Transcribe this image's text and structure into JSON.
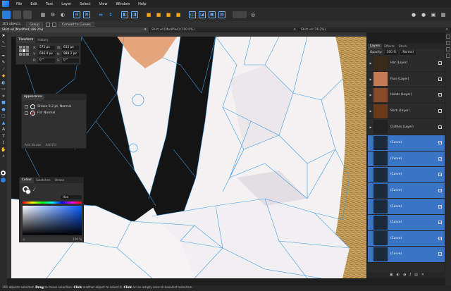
{
  "menu": [
    "File",
    "Edit",
    "Text",
    "Layer",
    "Select",
    "View",
    "Window",
    "Help"
  ],
  "context": {
    "object_count": "101 objects",
    "group_label": "Group",
    "convert_label": "Convert to Curves"
  },
  "doc_tabs": [
    {
      "label": "Shirt.vd [Modified] (86.2%)",
      "active": true
    },
    {
      "label": "Shirt.vd [Modified] (100.0%)",
      "active": false
    },
    {
      "label": "Shirt.vd (36.2%)",
      "active": false
    }
  ],
  "transform": {
    "tabs": [
      "Transform",
      "History"
    ],
    "x": "572 px",
    "w": "615 px",
    "y": "696.4 px",
    "h": "988.2 px",
    "r": "0 °",
    "s": "0 °"
  },
  "appearance": {
    "title": "Appearance",
    "stroke_label": "Stroke 0.2 pt, Normal",
    "fill_label": "Fill: Normal",
    "add_stroke": "Add Stroke",
    "add_fill": "Add Fill"
  },
  "colour": {
    "tabs": [
      "Colour",
      "Swatches",
      "Stroke"
    ],
    "model": "Hue",
    "opacity": "100 %"
  },
  "layers": {
    "tabs": [
      "Layers",
      "Effects",
      "Stock"
    ],
    "opacity_label": "Opacity:",
    "opacity": "100 %",
    "blend": "Normal",
    "items": [
      {
        "label": "Hat (Layer)",
        "thumb": "#3a2a1a",
        "selected": false,
        "expandable": true
      },
      {
        "label": "Face (Layer)",
        "thumb": "#c47a52",
        "selected": false,
        "expandable": true
      },
      {
        "label": "Hands (Layer)",
        "thumb": "#8a4a2a",
        "selected": false,
        "expandable": true
      },
      {
        "label": "Stick (Layer)",
        "thumb": "#6a3a1a",
        "selected": false,
        "expandable": true
      },
      {
        "label": "Clothes (Layer)",
        "thumb": "#222222",
        "selected": false,
        "expandable": true
      },
      {
        "label": "(Curve)",
        "thumb": "#1a2a3a",
        "selected": true,
        "expandable": false
      },
      {
        "label": "(Curve)",
        "thumb": "#1a2a3a",
        "selected": true,
        "expandable": false
      },
      {
        "label": "(Curve)",
        "thumb": "#1a2a3a",
        "selected": true,
        "expandable": false
      },
      {
        "label": "(Curve)",
        "thumb": "#1a2a3a",
        "selected": true,
        "expandable": false
      },
      {
        "label": "(Curve)",
        "thumb": "#1a2a3a",
        "selected": true,
        "expandable": false
      },
      {
        "label": "(Curve)",
        "thumb": "#1a2a3a",
        "selected": true,
        "expandable": false
      },
      {
        "label": "(Curve)",
        "thumb": "#1a2a3a",
        "selected": true,
        "expandable": false
      },
      {
        "label": "(Curve)",
        "thumb": "#1a2a3a",
        "selected": true,
        "expandable": false
      }
    ]
  },
  "status": {
    "count": "101 objects selected.",
    "drag": "Drag",
    "t1": " to move selection. ",
    "click1": "Click",
    "t2": " another object to select it. ",
    "click2": "Click",
    "t3": " on an empty area to deselect selection."
  },
  "colors": {
    "accent": "#3a74c4",
    "shirt": "#f4f1f3",
    "vest": "#151515",
    "straw": "#c9a25b",
    "mesh": "#3d9be0"
  }
}
